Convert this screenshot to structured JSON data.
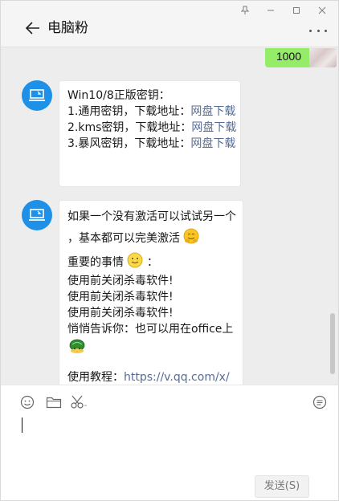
{
  "window": {
    "controls": [
      "pin",
      "minimize",
      "maximize",
      "close"
    ]
  },
  "header": {
    "title": "电脑粉"
  },
  "messages": {
    "self": {
      "text": "1000"
    },
    "msg1": {
      "lines": [
        {
          "text": "Win10/8正版密钥：",
          "link": ""
        },
        {
          "text": "1.通用密钥，下载地址：",
          "link": "网盘下载"
        },
        {
          "text": "2.kms密钥，下载地址：",
          "link": "网盘下载"
        },
        {
          "text": "3.暴风密钥，下载地址：",
          "link": "网盘下载"
        }
      ]
    },
    "msg2": {
      "line1": "如果一个没有激活可以试试另一个",
      "line2": "，基本都可以完美激活",
      "line3a": "重要的事情",
      "line3b": "：",
      "line4": "使用前关闭杀毒软件!",
      "line5": "使用前关闭杀毒软件!",
      "line6": "使用前关闭杀毒软件!",
      "line7": "悄悄告诉你：也可以用在office上",
      "line8_label": "使用教程：",
      "line8_link": "https://v.qq.com/x/"
    }
  },
  "input": {
    "send_label": "发送(S)"
  },
  "colors": {
    "self_bubble": "#95ec69",
    "link": "#576b95",
    "avatar": "#1e90e8"
  }
}
